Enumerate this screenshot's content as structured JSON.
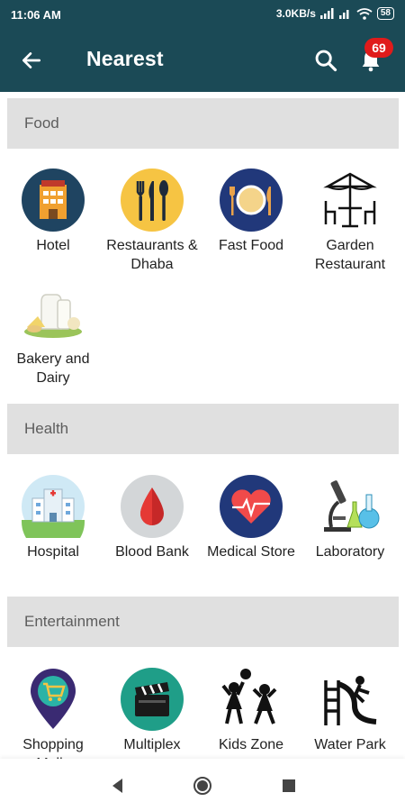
{
  "status": {
    "time": "11:06 AM",
    "net_speed": "3.0KB/s",
    "battery": "58"
  },
  "header": {
    "title": "Nearest",
    "notification_count": "69"
  },
  "sections": [
    {
      "name": "Food",
      "items": [
        {
          "label": "Hotel"
        },
        {
          "label": "Restaurants & Dhaba"
        },
        {
          "label": "Fast Food"
        },
        {
          "label": "Garden Restaurant"
        },
        {
          "label": "Bakery and Dairy"
        }
      ]
    },
    {
      "name": "Health",
      "items": [
        {
          "label": "Hospital"
        },
        {
          "label": "Blood Bank"
        },
        {
          "label": "Medical Store"
        },
        {
          "label": "Laboratory"
        }
      ]
    },
    {
      "name": "Entertainment",
      "items": [
        {
          "label": "Shopping Malls"
        },
        {
          "label": "Multiplex"
        },
        {
          "label": "Kids Zone"
        },
        {
          "label": "Water Park"
        }
      ]
    }
  ],
  "colors": {
    "app_bar": "#1b4a56",
    "badge": "#e01b1b",
    "section_bg": "#e0e0e0"
  }
}
